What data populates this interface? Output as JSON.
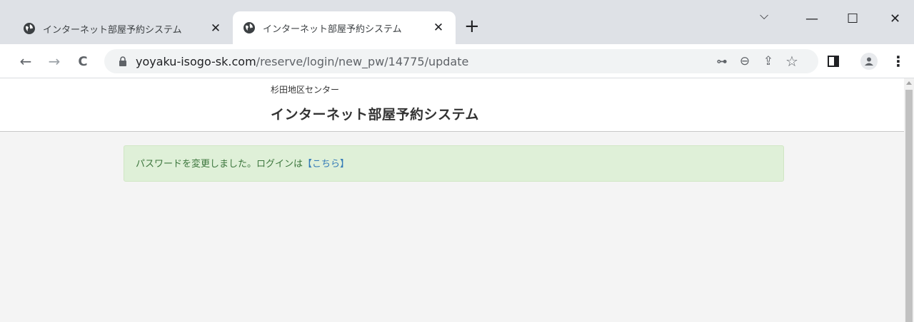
{
  "browser": {
    "tabs": [
      {
        "title": "インターネット部屋予約システム",
        "close": "✕",
        "active": false
      },
      {
        "title": "インターネット部屋予約システム",
        "close": "✕",
        "active": true
      }
    ],
    "new_tab": "+",
    "window_controls": {
      "minimize_chevron": "⌵",
      "minimize": "—",
      "maximize": "☐",
      "close": "✕"
    },
    "nav": {
      "back": "←",
      "forward": "→",
      "reload": "C"
    },
    "url": {
      "host": "yoyaku-isogo-sk.com",
      "path": "/reserve/login/new_pw/14775/update"
    },
    "toolbar_icons": {
      "key": "⊶",
      "zoom": "⊖",
      "share": "⇪",
      "star": "☆",
      "sidepanel": "▮",
      "menu": "⋮"
    }
  },
  "page": {
    "center_name": "杉田地区センター",
    "system_title": "インターネット部屋予約システム",
    "alert": {
      "message": "パスワードを変更しました。ログインは",
      "link": "【こちら】"
    }
  },
  "colors": {
    "alert_bg": "#dff0d8",
    "alert_text": "#3c763d",
    "link": "#337ab7"
  }
}
